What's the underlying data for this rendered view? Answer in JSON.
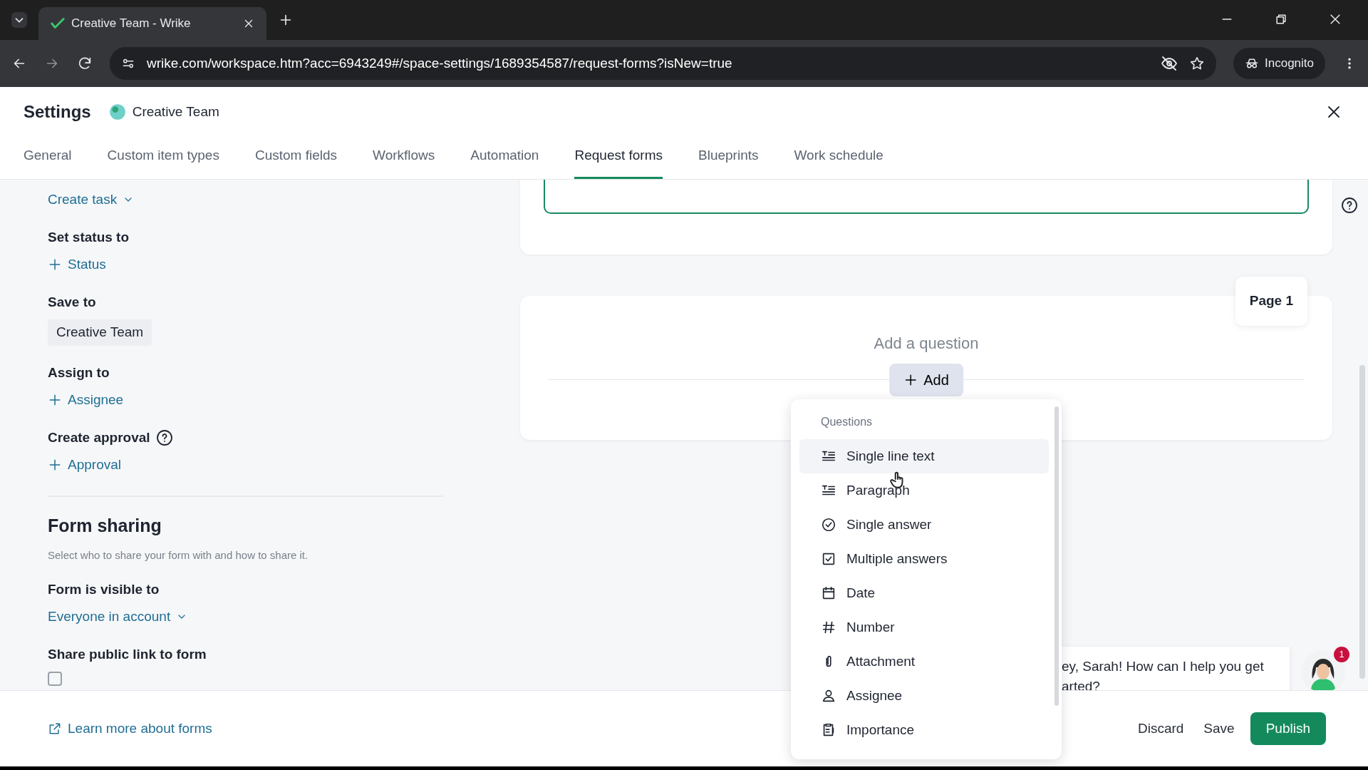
{
  "browser": {
    "tab_title": "Creative Team - Wrike",
    "url": "wrike.com/workspace.htm?acc=6943249#/space-settings/1689354587/request-forms?isNew=true",
    "profile": "Incognito"
  },
  "header": {
    "title": "Settings",
    "space": "Creative Team"
  },
  "tabs": [
    {
      "label": "General",
      "selected": false
    },
    {
      "label": "Custom item types",
      "selected": false
    },
    {
      "label": "Custom fields",
      "selected": false
    },
    {
      "label": "Workflows",
      "selected": false
    },
    {
      "label": "Automation",
      "selected": false
    },
    {
      "label": "Request forms",
      "selected": true
    },
    {
      "label": "Blueprints",
      "selected": false
    },
    {
      "label": "Work schedule",
      "selected": false
    }
  ],
  "sidebar": {
    "create_type": "Create task",
    "fields": [
      {
        "label": "Set status to",
        "kind": "add",
        "value": "Status",
        "help": false
      },
      {
        "label": "Save to",
        "kind": "chip",
        "value": "Creative Team",
        "help": false
      },
      {
        "label": "Assign to",
        "kind": "add",
        "value": "Assignee",
        "help": false
      },
      {
        "label": "Create approval",
        "kind": "add",
        "value": "Approval",
        "help": true
      }
    ],
    "sharing": {
      "title": "Form sharing",
      "description": "Select who to share your form with and how to share it.",
      "visible_label": "Form is visible to",
      "visible_value": "Everyone in account",
      "public_link_label": "Share public link to form",
      "public_link_checked": false
    }
  },
  "form": {
    "page_label": "Page 1",
    "prompt": "Add a question",
    "add_button": "Add"
  },
  "menu": {
    "header": "Questions",
    "items": [
      {
        "label": "Single line text",
        "kind": "text",
        "hovered": true
      },
      {
        "label": "Paragraph",
        "kind": "text",
        "hovered": false
      },
      {
        "label": "Single answer",
        "kind": "radio",
        "hovered": false
      },
      {
        "label": "Multiple answers",
        "kind": "checkbox",
        "hovered": false
      },
      {
        "label": "Date",
        "kind": "date",
        "hovered": false
      },
      {
        "label": "Number",
        "kind": "number",
        "hovered": false
      },
      {
        "label": "Attachment",
        "kind": "attachment",
        "hovered": false
      },
      {
        "label": "Assignee",
        "kind": "person",
        "hovered": false
      },
      {
        "label": "Importance",
        "kind": "importance",
        "hovered": false
      }
    ]
  },
  "chat": {
    "message": "ey, Sarah! How can I help you get arted?",
    "badge": "1"
  },
  "footer": {
    "learn_more": "Learn more about forms",
    "buttons": [
      {
        "label": "Discard",
        "kind": "text"
      },
      {
        "label": "Save",
        "kind": "text"
      },
      {
        "label": "Publish",
        "kind": "primary"
      }
    ]
  }
}
